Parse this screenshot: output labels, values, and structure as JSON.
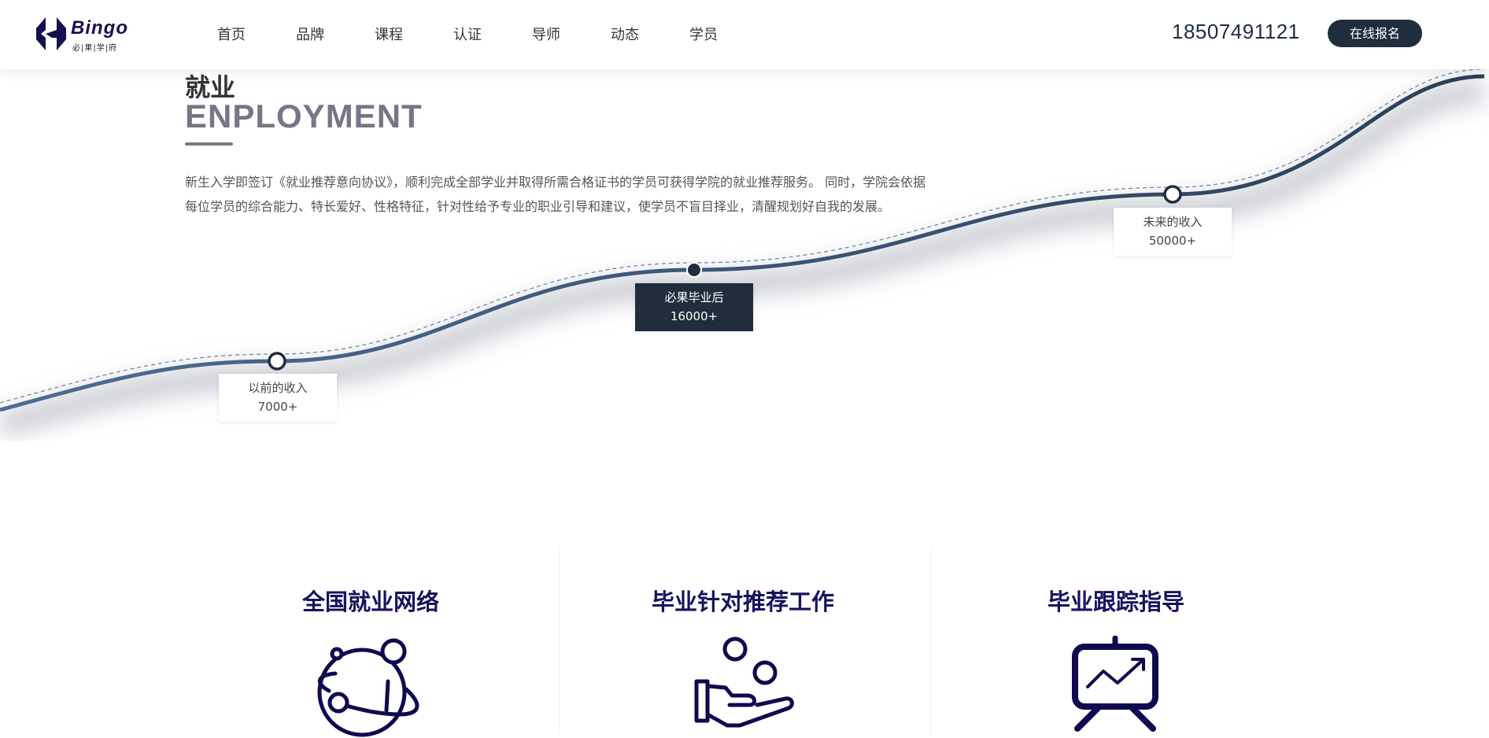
{
  "header": {
    "logo": {
      "word": "Bingo",
      "sub": "必|果|学|府"
    },
    "nav": [
      "首页",
      "品牌",
      "课程",
      "认证",
      "导师",
      "动态",
      "学员"
    ],
    "phone": "18507491121",
    "signup_label": "在线报名"
  },
  "employment": {
    "title_cn": "就业",
    "title_en": "ENPLOYMENT",
    "description": "新生入学即签订《就业推荐意向协议》，顺利完成全部学业并取得所需合格证书的学员可获得学院的就业推荐服务。 同时，学院会依据每位学员的综合能力、特长爱好、性格特征，针对性给予专业的职业引导和建议，使学员不盲目择业，清醒规划好自我的发展。",
    "milestones": [
      {
        "label": "以前的收入",
        "value": "7000+"
      },
      {
        "label": "必果毕业后",
        "value": "16000+"
      },
      {
        "label": "未来的收入",
        "value": "50000+"
      }
    ],
    "colors": {
      "curve": "#3a5a82",
      "dark": "#1f2d3d",
      "accent": "#787586"
    }
  },
  "features": [
    {
      "title": "全国就业网络",
      "icon": "globe-network-icon"
    },
    {
      "title": "毕业针对推荐工作",
      "icon": "hand-coins-icon"
    },
    {
      "title": "毕业跟踪指导",
      "icon": "chart-board-icon"
    }
  ]
}
